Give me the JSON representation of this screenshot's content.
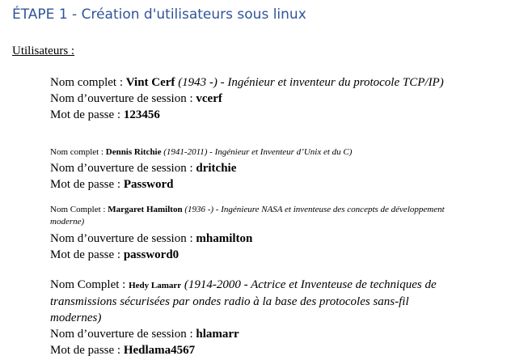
{
  "document": {
    "heading": "ÉTAPE 1 - Création d'utilisateurs sous linux",
    "section_label": "Utilisateurs  :",
    "colors": {
      "heading": "#2f5597",
      "text": "#000000",
      "background": "#ffffff"
    },
    "users": [
      {
        "name_label": "Nom complet  : ",
        "name": "Vint Cerf",
        "bio": " (1943 -) - Ingénieur et inventeur du protocole TCP/IP)",
        "login_label": "Nom d’ouverture  de session  : ",
        "login": "vcerf",
        "password_label": "Mot de passe : ",
        "password": "123456"
      },
      {
        "name_label": "Nom  complet : ",
        "name": "Dennis Ritchie",
        "bio": " (1941-2011) - Ingénieur et Inventeur d’Unix et du C)",
        "login_label": "Nom d’ouverture  de session  : ",
        "login": "dritchie",
        "password_label": "Mot de passe : ",
        "password": "Password"
      },
      {
        "name_label": "Nom Complet : ",
        "name": "Margaret Hamilton",
        "bio": "  (1936 -) - Ingénieure NASA et inventeuse des concepts de développement moderne)",
        "login_label": "Nom d’ouverture  de session  : ",
        "login": "mhamilton",
        "password_label": "Mot de passe : ",
        "password": "password0"
      },
      {
        "name_label": "Nom Complet  : ",
        "name": "Hedy Lamarr",
        "bio": "  (1914-2000 - Actrice et Inventeuse de techniques de transmissions sécurisées par ondes radio à la base des protocoles sans-fil modernes)",
        "login_label": "Nom d’ouverture  de session  : ",
        "login": "hlamarr",
        "password_label": "Mot de passe : ",
        "password": "Hedlama4567"
      }
    ]
  }
}
